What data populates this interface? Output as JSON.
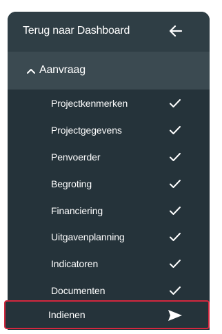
{
  "back": {
    "label": "Terug naar Dashboard",
    "icon": "arrow-left-icon"
  },
  "section": {
    "label": "Aanvraag",
    "icon": "chevron-up-icon",
    "expanded": true
  },
  "items": [
    {
      "label": "Projectkenmerken",
      "status": "completed",
      "icon": "check-icon"
    },
    {
      "label": "Projectgegevens",
      "status": "completed",
      "icon": "check-icon"
    },
    {
      "label": "Penvoerder",
      "status": "completed",
      "icon": "check-icon"
    },
    {
      "label": "Begroting",
      "status": "completed",
      "icon": "check-icon"
    },
    {
      "label": "Financiering",
      "status": "completed",
      "icon": "check-icon"
    },
    {
      "label": "Uitgavenplanning",
      "status": "completed",
      "icon": "check-icon"
    },
    {
      "label": "Indicatoren",
      "status": "completed",
      "icon": "check-icon"
    },
    {
      "label": "Documenten",
      "status": "completed",
      "icon": "check-icon"
    }
  ],
  "submit": {
    "label": "Indienen",
    "icon": "send-icon",
    "highlighted": true
  },
  "colors": {
    "panel_bg": "#25333a",
    "back_bg": "#2f3e45",
    "section_bg": "#3b4a51",
    "text": "#ffffff",
    "highlight_border": "#d3273e"
  }
}
